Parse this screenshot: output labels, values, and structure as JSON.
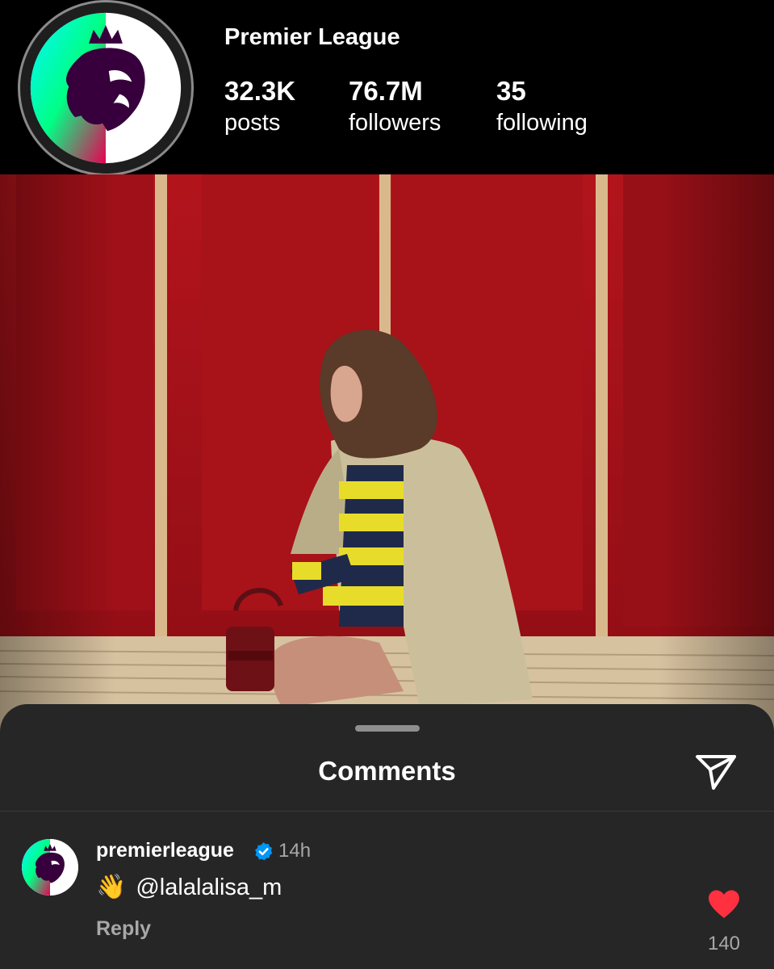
{
  "profile": {
    "name": "Premier League",
    "stats": [
      {
        "value": "32.3K",
        "label": "posts"
      },
      {
        "value": "76.7M",
        "label": "followers"
      },
      {
        "value": "35",
        "label": "following"
      }
    ]
  },
  "sheet": {
    "title": "Comments",
    "share_icon": "paper-plane-icon"
  },
  "comment": {
    "username": "premierleague",
    "verified": true,
    "time": "14h",
    "emoji": "👋",
    "text": "@lalalalisa_m",
    "reply_label": "Reply",
    "liked": true,
    "like_count": "140",
    "like_color": "#ff3040"
  },
  "colors": {
    "verified_badge": "#0095f6",
    "brand_purple": "#37003c",
    "locker_red": "#a80f18"
  }
}
